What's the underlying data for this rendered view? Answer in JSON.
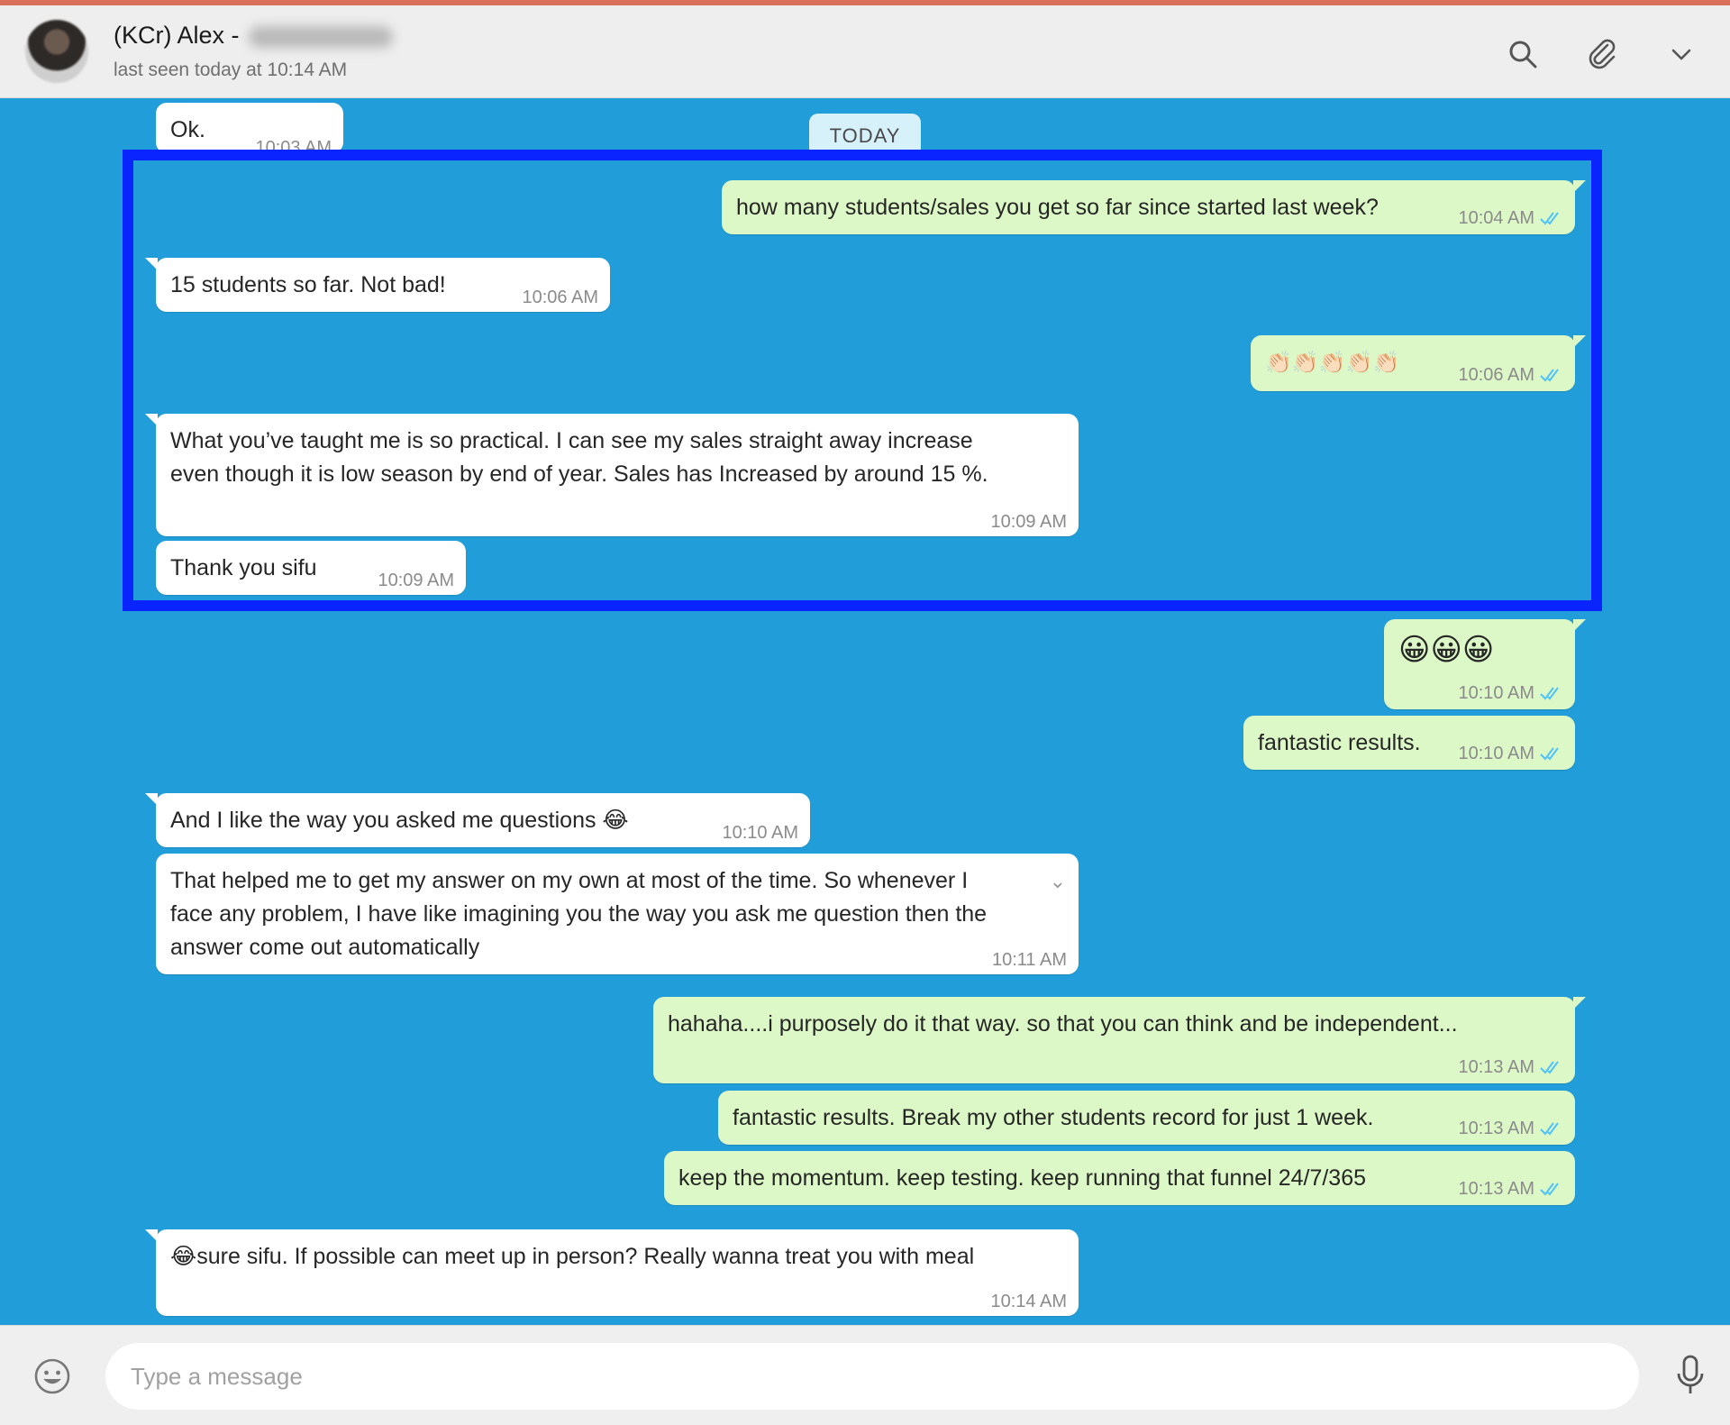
{
  "header": {
    "contact_name": "(KCr) Alex -",
    "last_seen": "last seen today at 10:14 AM"
  },
  "date_divider": "TODAY",
  "messages": [
    {
      "dir": "in",
      "text": "Ok.",
      "time": "10:03 AM"
    },
    {
      "dir": "out",
      "text": "how many students/sales you get so far since started last week?",
      "time": "10:04 AM",
      "read": true
    },
    {
      "dir": "in",
      "text": "15 students so far. Not bad!",
      "time": "10:06 AM"
    },
    {
      "dir": "out",
      "text": "👏🏻👏🏻👏🏻👏🏻👏🏻",
      "time": "10:06 AM",
      "read": true
    },
    {
      "dir": "in",
      "text": "What you’ve taught me is so practical. I can see my sales straight away increase\neven though it is low season by end of year. Sales has Increased by around 15 %.",
      "time": "10:09 AM"
    },
    {
      "dir": "in",
      "text": "Thank you sifu",
      "time": "10:09 AM"
    },
    {
      "dir": "out",
      "text": "😀😀😀",
      "time": "10:10 AM",
      "read": true
    },
    {
      "dir": "out",
      "text": "fantastic results.",
      "time": "10:10 AM",
      "read": true
    },
    {
      "dir": "in",
      "text": "And I like the way you asked me questions 😂",
      "time": "10:10 AM"
    },
    {
      "dir": "in",
      "text": "That helped me to get my answer on my own at most of the time. So whenever I\nface any problem, I have like imagining you the way you ask me question then the\nanswer come out automatically",
      "time": "10:11 AM"
    },
    {
      "dir": "out",
      "text": "hahaha....i purposely do it that way. so that you can think and be independent...",
      "time": "10:13 AM",
      "read": true
    },
    {
      "dir": "out",
      "text": "fantastic results. Break my other students record for just 1 week.",
      "time": "10:13 AM",
      "read": true
    },
    {
      "dir": "out",
      "text": "keep the momentum. keep testing. keep running that funnel 24/7/365",
      "time": "10:13 AM",
      "read": true
    },
    {
      "dir": "in",
      "text": "😂sure sifu. If possible can meet up in person? Really wanna treat you with meal",
      "time": "10:14 AM"
    }
  ],
  "composer": {
    "placeholder": "Type a message"
  },
  "colors": {
    "chat_background": "#219ed9",
    "incoming_bubble": "#ffffff",
    "outgoing_bubble": "#dcf8c6",
    "highlight_border": "#0a24ff",
    "read_ticks": "#4fc3f7"
  },
  "icons": {
    "header": [
      "search-icon",
      "paperclip-icon",
      "chevron-down-icon"
    ],
    "composer": [
      "smiley-icon",
      "microphone-icon"
    ]
  }
}
